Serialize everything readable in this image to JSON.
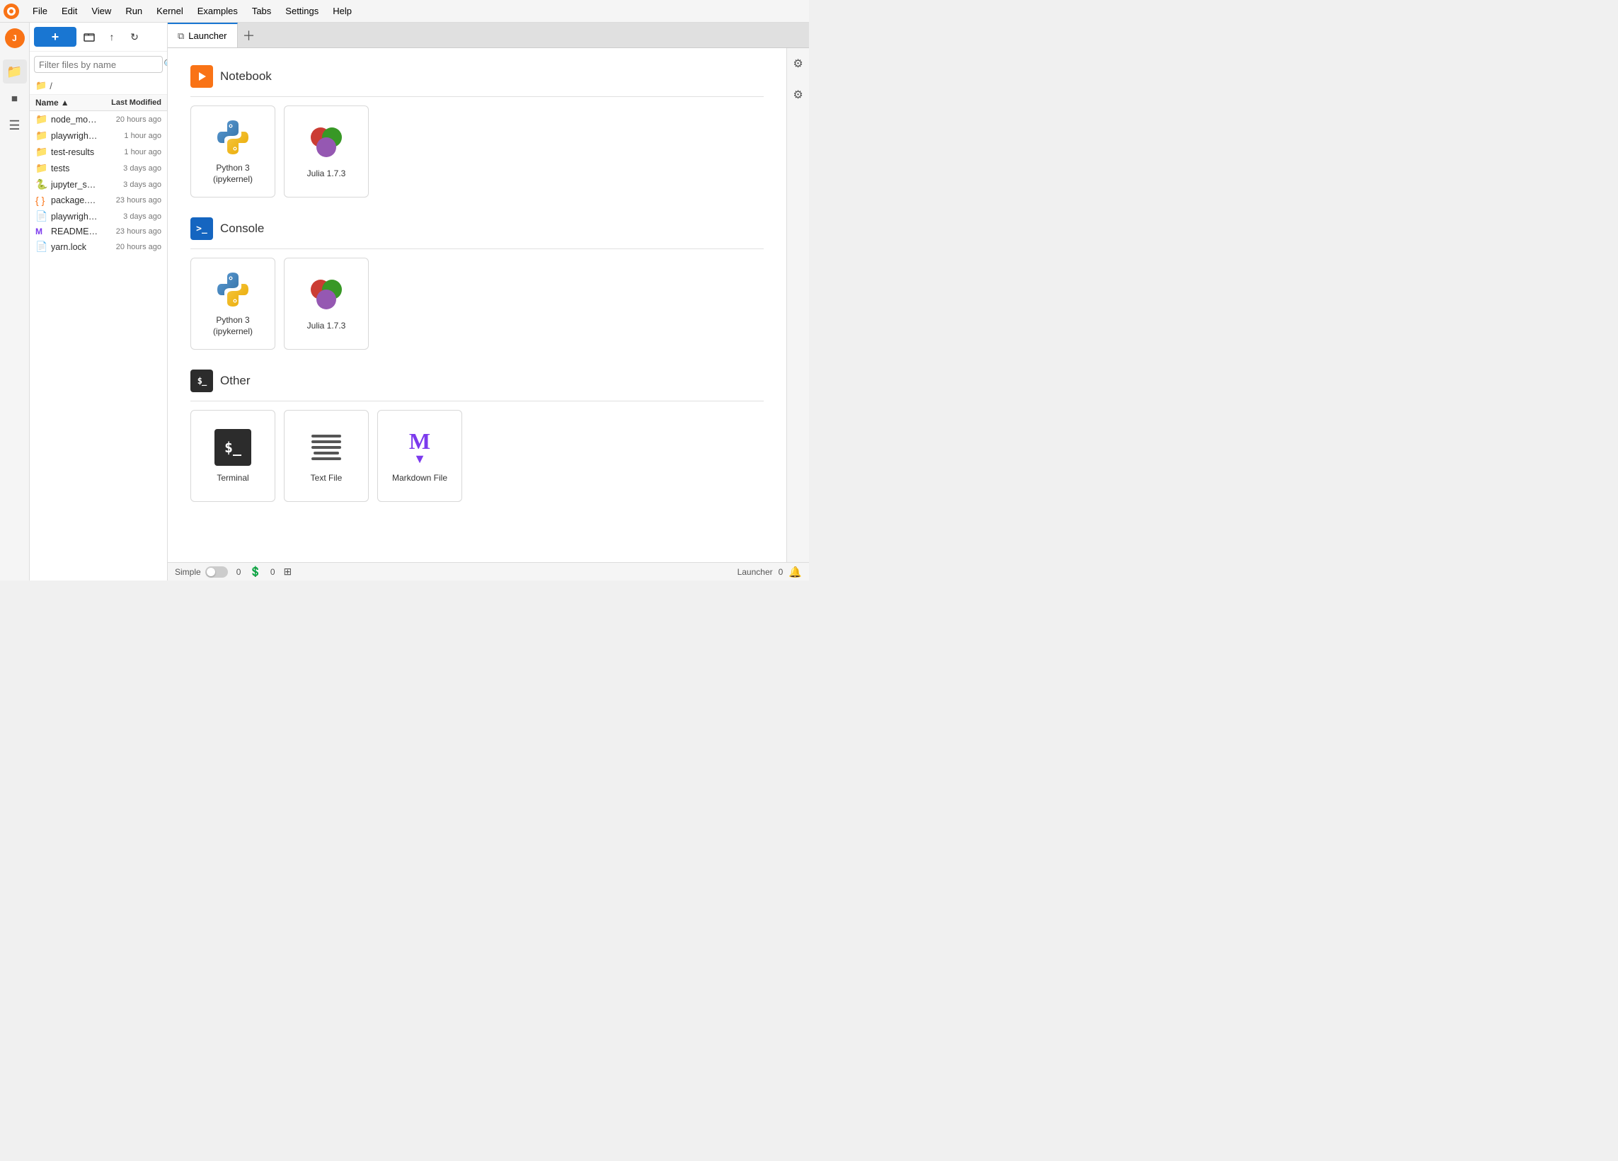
{
  "menubar": {
    "items": [
      "File",
      "Edit",
      "View",
      "Run",
      "Kernel",
      "Examples",
      "Tabs",
      "Settings",
      "Help"
    ]
  },
  "filepanel": {
    "search_placeholder": "Filter files by name",
    "breadcrumb": "/",
    "header": {
      "name_col": "Name",
      "modified_col": "Last Modified"
    },
    "files": [
      {
        "name": "node_mod...",
        "time": "20 hours ago",
        "type": "folder"
      },
      {
        "name": "playwright-...",
        "time": "1 hour ago",
        "type": "folder"
      },
      {
        "name": "test-results",
        "time": "1 hour ago",
        "type": "folder"
      },
      {
        "name": "tests",
        "time": "3 days ago",
        "type": "folder"
      },
      {
        "name": "jupyter_se...",
        "time": "3 days ago",
        "type": "python"
      },
      {
        "name": "package.json",
        "time": "23 hours ago",
        "type": "json"
      },
      {
        "name": "playwright....",
        "time": "3 days ago",
        "type": "file"
      },
      {
        "name": "README....",
        "time": "23 hours ago",
        "type": "markdown"
      },
      {
        "name": "yarn.lock",
        "time": "20 hours ago",
        "type": "file"
      }
    ]
  },
  "tabs": [
    {
      "label": "Launcher",
      "icon": "⧉",
      "active": true
    }
  ],
  "launcher": {
    "sections": [
      {
        "id": "notebook",
        "title": "Notebook",
        "icon_label": "▶",
        "cards": [
          {
            "label": "Python 3\n(ipykernel)",
            "type": "python"
          },
          {
            "label": "Julia 1.7.3",
            "type": "julia"
          }
        ]
      },
      {
        "id": "console",
        "title": "Console",
        "icon_label": ">_",
        "cards": [
          {
            "label": "Python 3\n(ipykernel)",
            "type": "python"
          },
          {
            "label": "Julia 1.7.3",
            "type": "julia"
          }
        ]
      },
      {
        "id": "other",
        "title": "Other",
        "icon_label": "$_",
        "cards": [
          {
            "label": "Terminal",
            "type": "terminal"
          },
          {
            "label": "Text File",
            "type": "textfile"
          },
          {
            "label": "Markdown File",
            "type": "markdown"
          }
        ]
      }
    ]
  },
  "statusbar": {
    "simple_label": "Simple",
    "left_count": "0",
    "right_label": "Launcher",
    "right_count": "0"
  }
}
